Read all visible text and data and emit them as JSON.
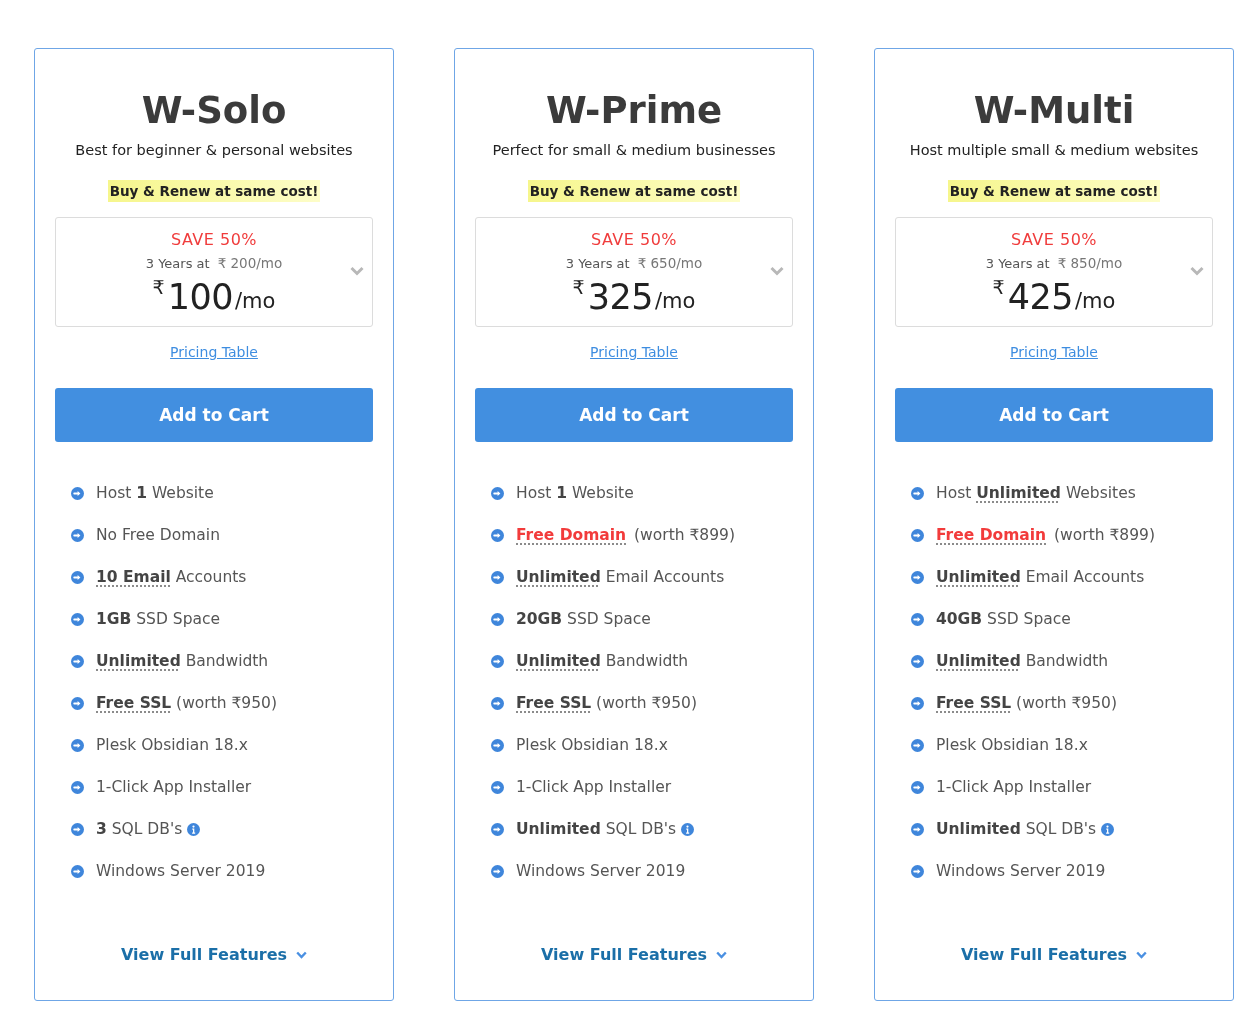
{
  "plans": [
    {
      "name": "W-Solo",
      "description": "Best for beginner & personal websites",
      "highlight": "Buy & Renew at same cost!",
      "offer": {
        "discount": "SAVE 50%",
        "term": "3 Years at",
        "old_price": "₹ 200/mo",
        "currency": "₹",
        "amount": "100",
        "period": "/mo"
      },
      "link": "Pricing Table",
      "button": "Add to Cart",
      "features": [
        {
          "text": "Host **1** Website",
          "kind": "plain",
          "info": false
        },
        {
          "text": "No Free Domain",
          "kind": "plain",
          "info": false
        },
        {
          "text": "**10 Email** Accounts",
          "kind": "hint",
          "info": false
        },
        {
          "text": "**1GB** SSD Space",
          "kind": "plain",
          "info": false
        },
        {
          "text": "**Unlimited** Bandwidth",
          "kind": "hint",
          "info": false
        },
        {
          "text": "**Free SSL** (worth ₹950)",
          "kind": "hint",
          "info": false
        },
        {
          "text": "Plesk Obsidian 18.x",
          "kind": "plain",
          "info": false
        },
        {
          "text": "1-Click App Installer",
          "kind": "plain",
          "info": false
        },
        {
          "text": "**3** SQL DB's",
          "kind": "plain",
          "info": true
        },
        {
          "text": "Windows Server 2019",
          "kind": "plain",
          "info": false
        }
      ],
      "more": "View Full Features"
    },
    {
      "name": "W-Prime",
      "description": "Perfect for small & medium businesses",
      "highlight": "Buy & Renew at same cost!",
      "offer": {
        "discount": "SAVE 50%",
        "term": "3 Years at",
        "old_price": "₹ 650/mo",
        "currency": "₹",
        "amount": "325",
        "period": "/mo"
      },
      "link": "Pricing Table",
      "button": "Add to Cart",
      "features": [
        {
          "text": "Host **1** Website",
          "kind": "plain",
          "info": false
        },
        {
          "text": "**Free Domain** (worth ₹899)",
          "kind": "promo",
          "info": false
        },
        {
          "text": "**Unlimited** Email Accounts",
          "kind": "hint",
          "info": false
        },
        {
          "text": "**20GB** SSD Space",
          "kind": "plain",
          "info": false
        },
        {
          "text": "**Unlimited** Bandwidth",
          "kind": "hint",
          "info": false
        },
        {
          "text": "**Free SSL** (worth ₹950)",
          "kind": "hint",
          "info": false
        },
        {
          "text": "Plesk Obsidian 18.x",
          "kind": "plain",
          "info": false
        },
        {
          "text": "1-Click App Installer",
          "kind": "plain",
          "info": false
        },
        {
          "text": "**Unlimited** SQL DB's",
          "kind": "plain",
          "info": true
        },
        {
          "text": "Windows Server 2019",
          "kind": "plain",
          "info": false
        }
      ],
      "more": "View Full Features"
    },
    {
      "name": "W-Multi",
      "description": "Host multiple small & medium websites",
      "highlight": "Buy & Renew at same cost!",
      "offer": {
        "discount": "SAVE 50%",
        "term": "3 Years at",
        "old_price": "₹ 850/mo",
        "currency": "₹",
        "amount": "425",
        "period": "/mo"
      },
      "link": "Pricing Table",
      "button": "Add to Cart",
      "features": [
        {
          "text": "Host **Unlimited** Websites",
          "kind": "hint",
          "info": false
        },
        {
          "text": "**Free Domain** (worth ₹899)",
          "kind": "promo",
          "info": false
        },
        {
          "text": "**Unlimited** Email Accounts",
          "kind": "hint",
          "info": false
        },
        {
          "text": "**40GB** SSD Space",
          "kind": "plain",
          "info": false
        },
        {
          "text": "**Unlimited** Bandwidth",
          "kind": "hint",
          "info": false
        },
        {
          "text": "**Free SSL** (worth ₹950)",
          "kind": "hint",
          "info": false
        },
        {
          "text": "Plesk Obsidian 18.x",
          "kind": "plain",
          "info": false
        },
        {
          "text": "1-Click App Installer",
          "kind": "plain",
          "info": false
        },
        {
          "text": "**Unlimited** SQL DB's",
          "kind": "plain",
          "info": true
        },
        {
          "text": "Windows Server 2019",
          "kind": "plain",
          "info": false
        }
      ],
      "more": "View Full Features"
    }
  ]
}
